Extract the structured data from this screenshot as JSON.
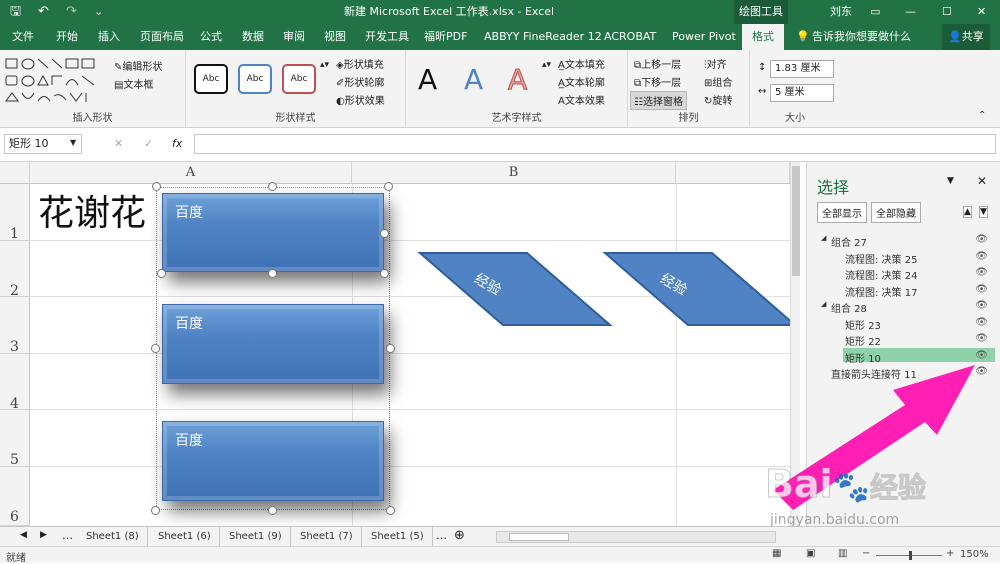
{
  "title_bar": {
    "file_title": "新建 Microsoft Excel 工作表.xlsx - Excel",
    "context_tool": "绘图工具",
    "user": "刘东",
    "save_icon": "save-icon",
    "undo_icon": "undo-icon",
    "redo_icon": "redo-icon"
  },
  "tabs": [
    "文件",
    "开始",
    "插入",
    "页面布局",
    "公式",
    "数据",
    "审阅",
    "视图",
    "开发工具",
    "福昕PDF",
    "ABBYY FineReader 12",
    "ACROBAT",
    "Power Pivot",
    "格式"
  ],
  "tell_me": "告诉我你想要做什么",
  "share": "共享",
  "ribbon": {
    "insert_shapes": {
      "label": "插入形状",
      "edit_shape": "编辑形状",
      "text_box": "文本框"
    },
    "shape_styles": {
      "label": "形状样式",
      "swatches": [
        "Abc",
        "Abc",
        "Abc"
      ],
      "fill": "形状填充",
      "outline": "形状轮廓",
      "effects": "形状效果"
    },
    "wordart": {
      "label": "艺术字样式",
      "letters": [
        "A",
        "A",
        "A"
      ],
      "text_fill": "文本填充",
      "text_outline": "文本轮廓",
      "text_effects": "文本效果"
    },
    "arrange": {
      "label": "排列",
      "bring_forward": "上移一层",
      "send_backward": "下移一层",
      "selection_pane": "选择窗格",
      "align": "对齐",
      "group": "组合",
      "rotate": "旋转"
    },
    "size": {
      "label": "大小",
      "height": "1.83 厘米",
      "width": "5 厘米"
    }
  },
  "formula_bar": {
    "name_box": "矩形 10",
    "fx": "fx",
    "value": ""
  },
  "sheet": {
    "columns": [
      "A",
      "B"
    ],
    "rows": [
      "1",
      "2",
      "3",
      "4",
      "5",
      "6"
    ],
    "cell_a1": "花谢花",
    "rect_texts": [
      "百度",
      "百度",
      "百度"
    ],
    "parallelogram_texts": [
      "经验",
      "经验"
    ]
  },
  "selection_pane": {
    "title": "选择",
    "show_all": "全部显示",
    "hide_all": "全部隐藏",
    "items": [
      {
        "label": "组合 27",
        "level": 0,
        "selected": false
      },
      {
        "label": "流程图: 决策 25",
        "level": 1,
        "selected": false
      },
      {
        "label": "流程图: 决策 24",
        "level": 1,
        "selected": false
      },
      {
        "label": "流程图: 决策 17",
        "level": 1,
        "selected": false
      },
      {
        "label": "组合 28",
        "level": 0,
        "selected": false
      },
      {
        "label": "矩形 23",
        "level": 1,
        "selected": false
      },
      {
        "label": "矩形 22",
        "level": 1,
        "selected": false
      },
      {
        "label": "矩形 10",
        "level": 1,
        "selected": true
      },
      {
        "label": "直接箭头连接符 11",
        "level": 0,
        "selected": false
      }
    ],
    "selected_color": "#8fd1a8"
  },
  "sheet_tabs": [
    "Sheet1 (8)",
    "Sheet1 (6)",
    "Sheet1 (9)",
    "Sheet1 (7)",
    "Sheet1 (5)"
  ],
  "status": {
    "ready": "就绪",
    "zoom": "150%"
  },
  "watermark": {
    "brand": "Bai",
    "brand2": "经验",
    "url": "jingyan.baidu.com"
  },
  "colors": {
    "excel_green": "#217346",
    "shape_blue": "#4f83c4",
    "arrow_pink": "#ff1fb4"
  }
}
